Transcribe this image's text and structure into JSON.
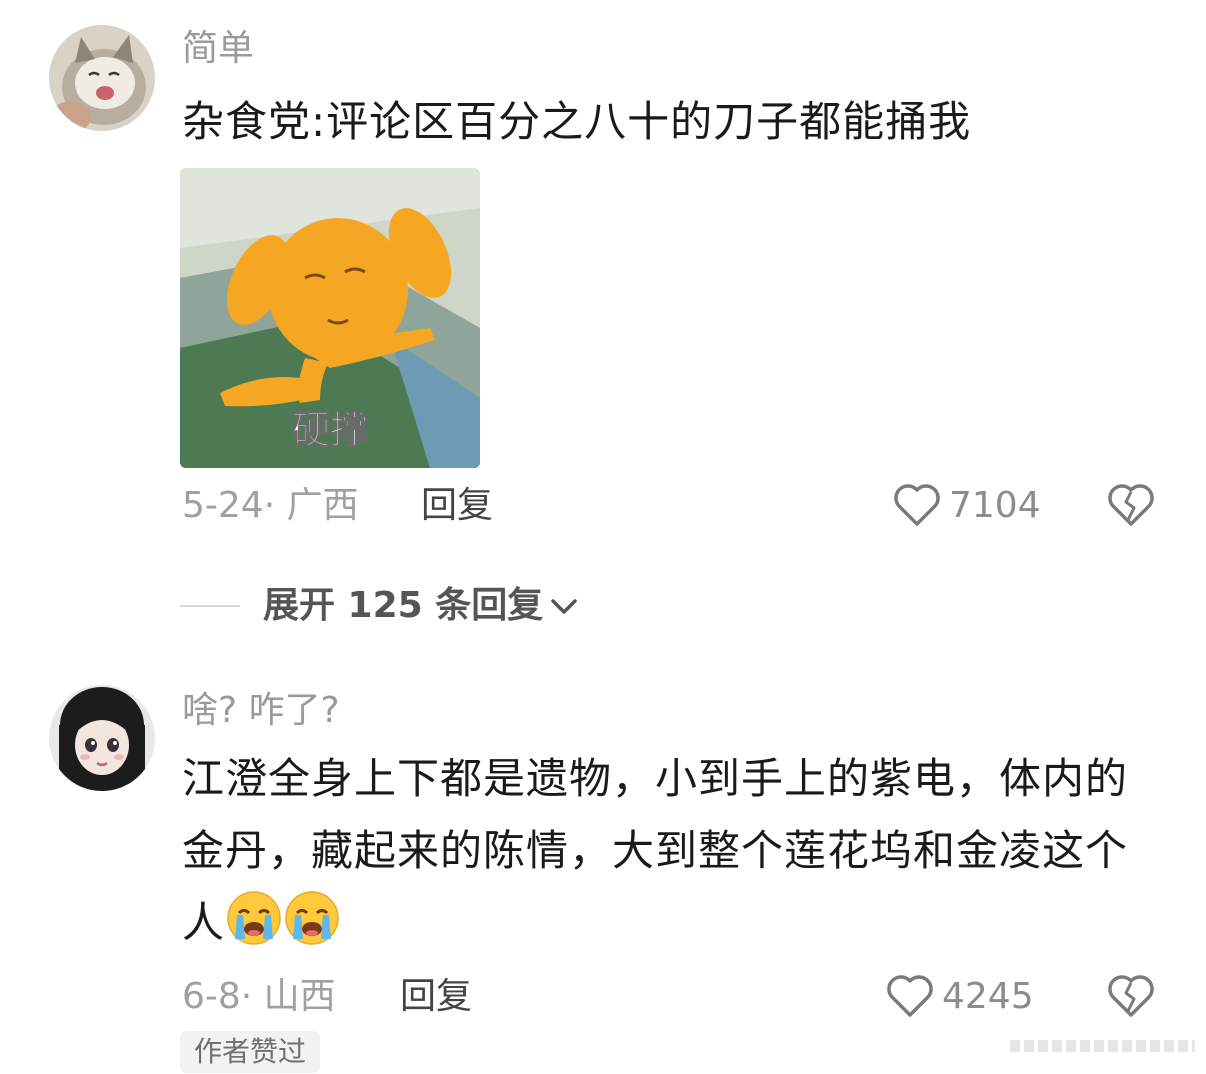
{
  "comments": [
    {
      "username": "简单",
      "text": "杂食党:评论区百分之八十的刀子都能捅我",
      "sticker_caption": "硬撑",
      "date_location": "5-24· 广西",
      "reply_label": "回复",
      "like_count": "7104"
    },
    {
      "username": "啥? 咋了?",
      "text": "江澄全身上下都是遗物，小到手上的紫电，体内的金丹，藏起来的陈情，大到整个莲花坞和金凌这个人",
      "emoji_count": 2,
      "date_location": "6-8· 山西",
      "reply_label": "回复",
      "like_count": "4245",
      "author_badge": "作者赞过"
    }
  ],
  "expand_replies_label": "展开 125 条回复",
  "colors": {
    "text_primary": "#1a1a1a",
    "text_secondary": "#9a9a9a",
    "sticker_orange": "#f5a623"
  },
  "icons": [
    "heart-icon",
    "broken-heart-icon",
    "chevron-down-icon",
    "crying-emoji-icon"
  ]
}
